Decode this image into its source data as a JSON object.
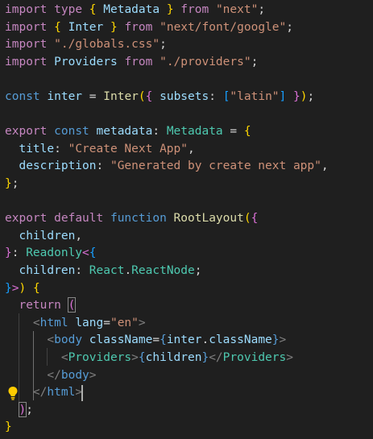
{
  "theme": {
    "background": "#1f1f1f",
    "keyword": "#c586c0",
    "storage": "#569cd6",
    "variable": "#9cdcfe",
    "function": "#dcdcaa",
    "type": "#4ec9b0",
    "string": "#ce9178",
    "plain": "#d4d4d4",
    "tag_bracket": "#808080",
    "bracket_gold": "#ffd700",
    "bracket_purple": "#da70d6",
    "bracket_blue": "#179fff",
    "indent_guide": "#404040",
    "indent_guide_active": "#707070",
    "bulb": "#ffcc00",
    "cursor": "#aeafad",
    "match_border": "#888888"
  },
  "icons": {
    "lightbulb": "lightbulb-icon"
  },
  "code_lines": [
    [
      [
        "import",
        "keyword"
      ],
      [
        " ",
        "plain"
      ],
      [
        "type",
        "keyword"
      ],
      [
        " ",
        "plain"
      ],
      [
        "{",
        "bracket_gold"
      ],
      [
        " ",
        "plain"
      ],
      [
        "Metadata",
        "variable"
      ],
      [
        " ",
        "plain"
      ],
      [
        "}",
        "bracket_gold"
      ],
      [
        " ",
        "plain"
      ],
      [
        "from",
        "keyword"
      ],
      [
        " ",
        "plain"
      ],
      [
        "\"next\"",
        "string"
      ],
      [
        ";",
        "plain"
      ]
    ],
    [
      [
        "import",
        "keyword"
      ],
      [
        " ",
        "plain"
      ],
      [
        "{",
        "bracket_gold"
      ],
      [
        " ",
        "plain"
      ],
      [
        "Inter",
        "variable"
      ],
      [
        " ",
        "plain"
      ],
      [
        "}",
        "bracket_gold"
      ],
      [
        " ",
        "plain"
      ],
      [
        "from",
        "keyword"
      ],
      [
        " ",
        "plain"
      ],
      [
        "\"next/font/google\"",
        "string"
      ],
      [
        ";",
        "plain"
      ]
    ],
    [
      [
        "import",
        "keyword"
      ],
      [
        " ",
        "plain"
      ],
      [
        "\"./globals.css\"",
        "string"
      ],
      [
        ";",
        "plain"
      ]
    ],
    [
      [
        "import",
        "keyword"
      ],
      [
        " ",
        "plain"
      ],
      [
        "Providers",
        "variable"
      ],
      [
        " ",
        "plain"
      ],
      [
        "from",
        "keyword"
      ],
      [
        " ",
        "plain"
      ],
      [
        "\"./providers\"",
        "string"
      ],
      [
        ";",
        "plain"
      ]
    ],
    [],
    [
      [
        "const",
        "storage"
      ],
      [
        " ",
        "plain"
      ],
      [
        "inter",
        "variable"
      ],
      [
        " ",
        "plain"
      ],
      [
        "=",
        "plain"
      ],
      [
        " ",
        "plain"
      ],
      [
        "Inter",
        "function"
      ],
      [
        "(",
        "bracket_gold"
      ],
      [
        "{",
        "bracket_purple"
      ],
      [
        " ",
        "plain"
      ],
      [
        "subsets",
        "variable"
      ],
      [
        ":",
        "plain"
      ],
      [
        " ",
        "plain"
      ],
      [
        "[",
        "bracket_blue"
      ],
      [
        "\"latin\"",
        "string"
      ],
      [
        "]",
        "bracket_blue"
      ],
      [
        " ",
        "plain"
      ],
      [
        "}",
        "bracket_purple"
      ],
      [
        ")",
        "bracket_gold"
      ],
      [
        ";",
        "plain"
      ]
    ],
    [],
    [
      [
        "export",
        "keyword"
      ],
      [
        " ",
        "plain"
      ],
      [
        "const",
        "storage"
      ],
      [
        " ",
        "plain"
      ],
      [
        "metadata",
        "variable"
      ],
      [
        ":",
        "plain"
      ],
      [
        " ",
        "plain"
      ],
      [
        "Metadata",
        "type"
      ],
      [
        " ",
        "plain"
      ],
      [
        "=",
        "plain"
      ],
      [
        " ",
        "plain"
      ],
      [
        "{",
        "bracket_gold"
      ]
    ],
    [
      [
        "  ",
        "plain"
      ],
      [
        "title",
        "variable"
      ],
      [
        ":",
        "plain"
      ],
      [
        " ",
        "plain"
      ],
      [
        "\"Create Next App\"",
        "string"
      ],
      [
        ",",
        "plain"
      ]
    ],
    [
      [
        "  ",
        "plain"
      ],
      [
        "description",
        "variable"
      ],
      [
        ":",
        "plain"
      ],
      [
        " ",
        "plain"
      ],
      [
        "\"Generated by create next app\"",
        "string"
      ],
      [
        ",",
        "plain"
      ]
    ],
    [
      [
        "}",
        "bracket_gold"
      ],
      [
        ";",
        "plain"
      ]
    ],
    [],
    [
      [
        "export",
        "keyword"
      ],
      [
        " ",
        "plain"
      ],
      [
        "default",
        "keyword"
      ],
      [
        " ",
        "plain"
      ],
      [
        "function",
        "storage"
      ],
      [
        " ",
        "plain"
      ],
      [
        "RootLayout",
        "function"
      ],
      [
        "(",
        "bracket_gold"
      ],
      [
        "{",
        "bracket_purple"
      ]
    ],
    [
      [
        "  ",
        "plain"
      ],
      [
        "children",
        "variable"
      ],
      [
        ",",
        "plain"
      ]
    ],
    [
      [
        "}",
        "bracket_purple"
      ],
      [
        ":",
        "plain"
      ],
      [
        " ",
        "plain"
      ],
      [
        "Readonly",
        "type"
      ],
      [
        "<",
        "bracket_purple"
      ],
      [
        "{",
        "bracket_blue"
      ]
    ],
    [
      [
        "  ",
        "plain"
      ],
      [
        "children",
        "variable"
      ],
      [
        ":",
        "plain"
      ],
      [
        " ",
        "plain"
      ],
      [
        "React",
        "type"
      ],
      [
        ".",
        "plain"
      ],
      [
        "ReactNode",
        "type"
      ],
      [
        ";",
        "plain"
      ]
    ],
    [
      [
        "}",
        "bracket_blue"
      ],
      [
        ">",
        "bracket_purple"
      ],
      [
        ")",
        "bracket_gold"
      ],
      [
        " ",
        "plain"
      ],
      [
        "{",
        "bracket_gold"
      ]
    ],
    [
      [
        "  ",
        "plain"
      ],
      [
        "return",
        "keyword"
      ],
      [
        " ",
        "plain"
      ],
      [
        "(",
        "bracket_purple"
      ]
    ],
    [
      [
        "    ",
        "plain"
      ],
      [
        "<",
        "tag_bracket"
      ],
      [
        "html",
        "storage"
      ],
      [
        " ",
        "plain"
      ],
      [
        "lang",
        "variable"
      ],
      [
        "=",
        "plain"
      ],
      [
        "\"en\"",
        "string"
      ],
      [
        ">",
        "tag_bracket"
      ]
    ],
    [
      [
        "      ",
        "plain"
      ],
      [
        "<",
        "tag_bracket"
      ],
      [
        "body",
        "storage"
      ],
      [
        " ",
        "plain"
      ],
      [
        "className",
        "variable"
      ],
      [
        "=",
        "plain"
      ],
      [
        "{",
        "storage"
      ],
      [
        "inter",
        "variable"
      ],
      [
        ".",
        "plain"
      ],
      [
        "className",
        "variable"
      ],
      [
        "}",
        "storage"
      ],
      [
        ">",
        "tag_bracket"
      ]
    ],
    [
      [
        "        ",
        "plain"
      ],
      [
        "<",
        "tag_bracket"
      ],
      [
        "Providers",
        "type"
      ],
      [
        ">",
        "tag_bracket"
      ],
      [
        "{",
        "storage"
      ],
      [
        "children",
        "variable"
      ],
      [
        "}",
        "storage"
      ],
      [
        "</",
        "tag_bracket"
      ],
      [
        "Providers",
        "type"
      ],
      [
        ">",
        "tag_bracket"
      ]
    ],
    [
      [
        "      ",
        "plain"
      ],
      [
        "</",
        "tag_bracket"
      ],
      [
        "body",
        "storage"
      ],
      [
        ">",
        "tag_bracket"
      ]
    ],
    [
      [
        "    ",
        "plain"
      ],
      [
        "</",
        "tag_bracket"
      ],
      [
        "html",
        "storage"
      ],
      [
        ">",
        "tag_bracket"
      ]
    ],
    [
      [
        "  ",
        "plain"
      ],
      [
        ")",
        "bracket_purple"
      ],
      [
        ";",
        "plain"
      ]
    ],
    [
      [
        "}",
        "bracket_gold"
      ]
    ]
  ]
}
